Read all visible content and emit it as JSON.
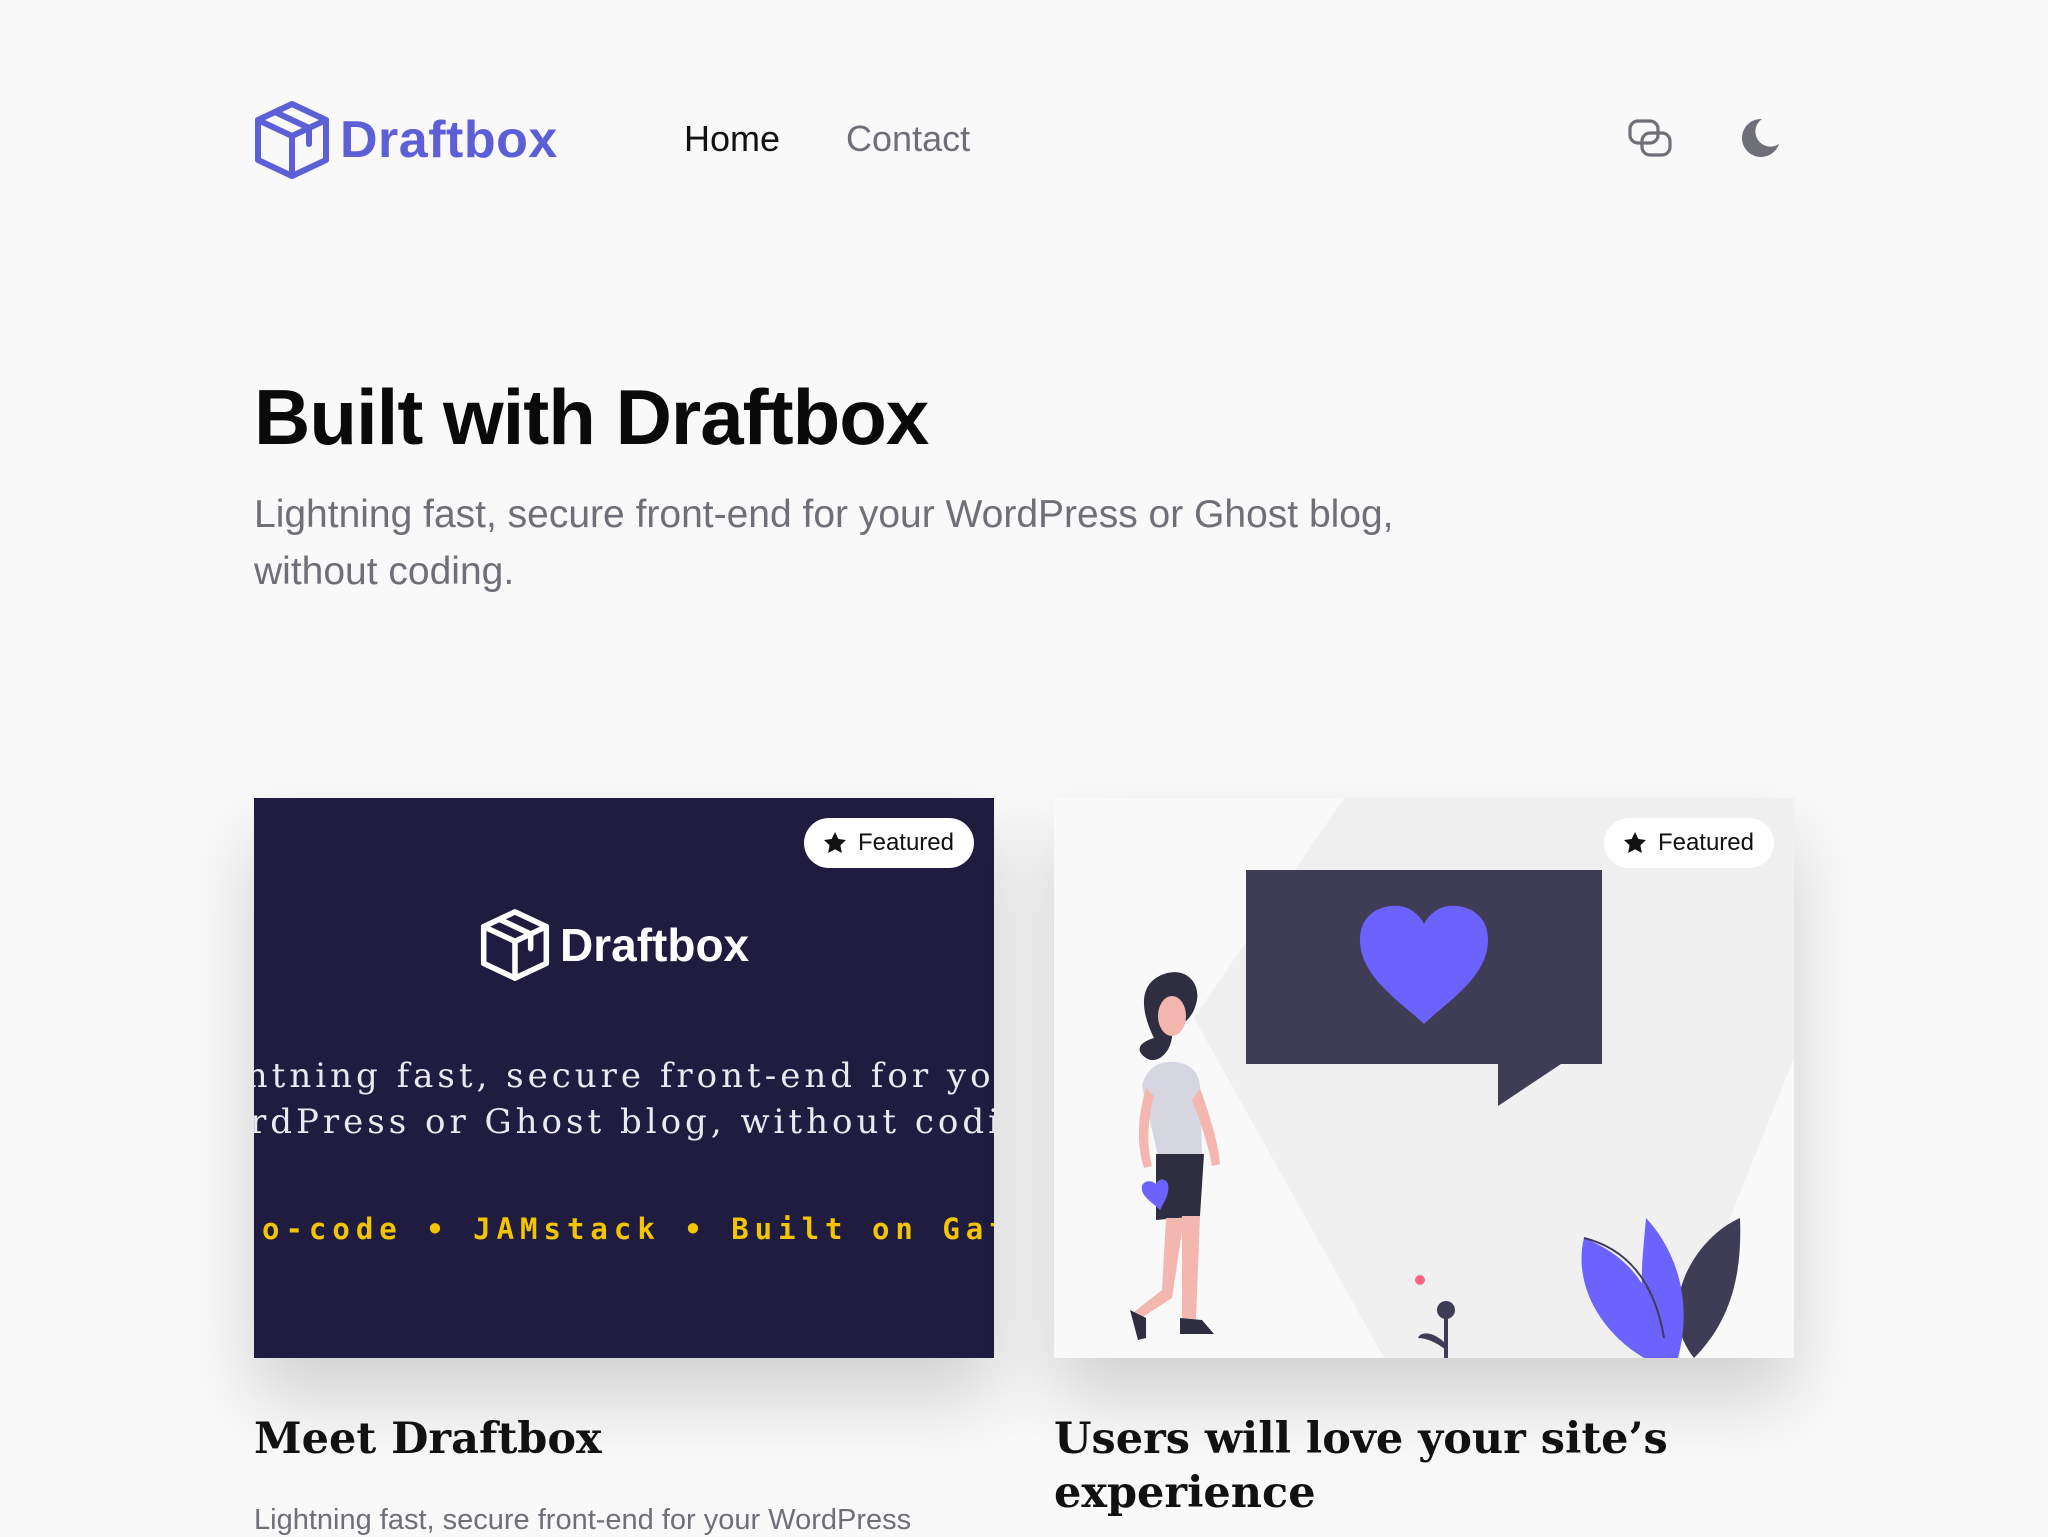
{
  "colors": {
    "brand": "#5d5fd7",
    "background": "#f9f9f9",
    "promo_background": "#1f1c40",
    "promo_accent": "#f2c500",
    "illustration_primary": "#6c63ff",
    "illustration_dark": "#3f3d56"
  },
  "header": {
    "logo_text": "Draftbox",
    "nav": [
      "Home",
      "Contact"
    ],
    "active_nav": "Home",
    "icons": [
      "link-icon",
      "moon-icon"
    ]
  },
  "hero": {
    "title": "Built with Draftbox",
    "subtitle": "Lightning fast, secure front-end for your WordPress or Ghost blog, without coding."
  },
  "posts": [
    {
      "badge": "Featured",
      "title": "Meet Draftbox",
      "excerpt": "Lightning fast, secure front-end for your WordPress",
      "image": {
        "logo_text": "Draftbox",
        "line1": "ghtning fast, secure front-end for yo",
        "line2": "rdPress or Ghost blog, without codi",
        "tags": "o-code • JAMstack • Built on Gatsb"
      }
    },
    {
      "badge": "Featured",
      "title": "Users will love your site’s experience",
      "excerpt": ""
    }
  ]
}
